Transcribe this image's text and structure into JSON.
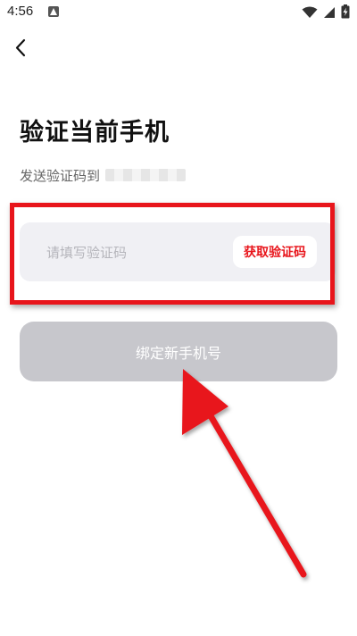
{
  "status_bar": {
    "time": "4:56"
  },
  "page": {
    "title": "验证当前手机",
    "subtitle": "发送验证码到"
  },
  "code_field": {
    "placeholder": "请填写验证码",
    "get_code_label": "获取验证码"
  },
  "bind_button": {
    "label": "绑定新手机号"
  },
  "colors": {
    "accent": "#e8151b",
    "field_bg": "#f0f0f4",
    "button_disabled": "#c7c7cc"
  }
}
